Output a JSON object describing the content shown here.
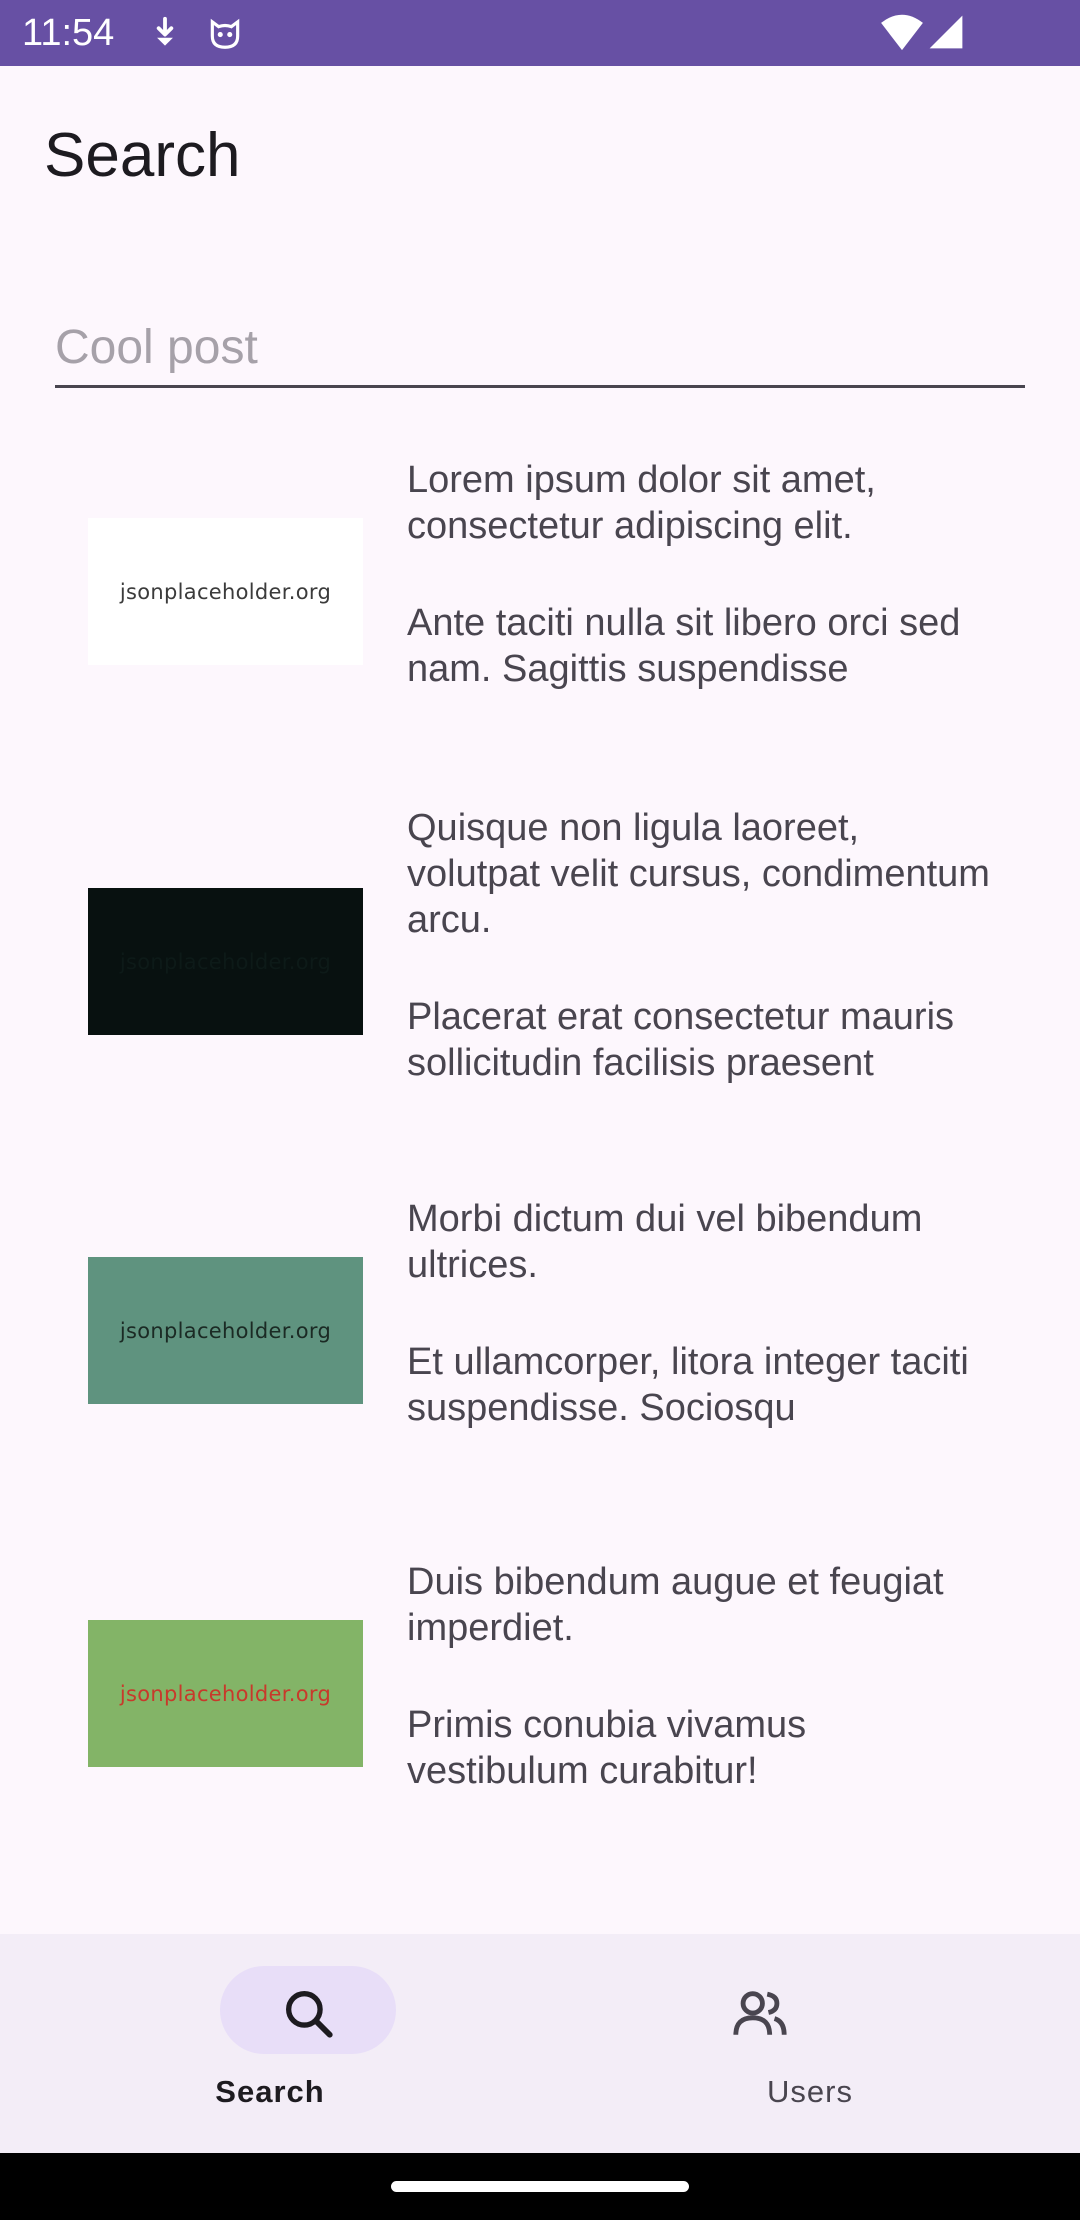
{
  "status_bar": {
    "time": "11:54",
    "background": "#6750a4",
    "icons": [
      "download-icon",
      "cat-face-icon",
      "wifi-icon",
      "cell-signal-icon"
    ]
  },
  "page": {
    "title": "Search"
  },
  "search": {
    "value": "",
    "placeholder": "Cool post"
  },
  "posts": [
    {
      "title": "Lorem ipsum dolor sit amet, consectetur adipiscing elit.",
      "body": "Ante taciti nulla sit libero orci sed nam. Sagittis suspendisse",
      "thumbnail": {
        "label": "jsonplaceholder.org",
        "background": "#ffffff",
        "text_color": "#3b3b3b"
      }
    },
    {
      "title": "Quisque non ligula laoreet, volutpat velit cursus, condimentum arcu.",
      "body": "Placerat erat consectetur mauris sollicitudin facilisis praesent",
      "thumbnail": {
        "label": "jsonplaceholder.org",
        "background": "#081110",
        "text_color": "#0d1a18"
      }
    },
    {
      "title": "Morbi dictum dui vel bibendum ultrices.",
      "body": "Et ullamcorper, litora integer taciti suspendisse. Sociosqu",
      "thumbnail": {
        "label": "jsonplaceholder.org",
        "background": "#5f937f",
        "text_color": "#1b2a24"
      }
    },
    {
      "title": "Duis bibendum augue et feugiat imperdiet.",
      "body": "Primis conubia vivamus vestibulum curabitur!",
      "thumbnail": {
        "label": "jsonplaceholder.org",
        "background": "#83b467",
        "text_color": "#c8392b"
      }
    }
  ],
  "bottom_nav": {
    "background": "#f3edf7",
    "items": [
      {
        "label": "Search",
        "icon": "search-icon",
        "selected": true,
        "indicator_color": "#e8def8"
      },
      {
        "label": "Users",
        "icon": "users-icon",
        "selected": false
      }
    ]
  }
}
